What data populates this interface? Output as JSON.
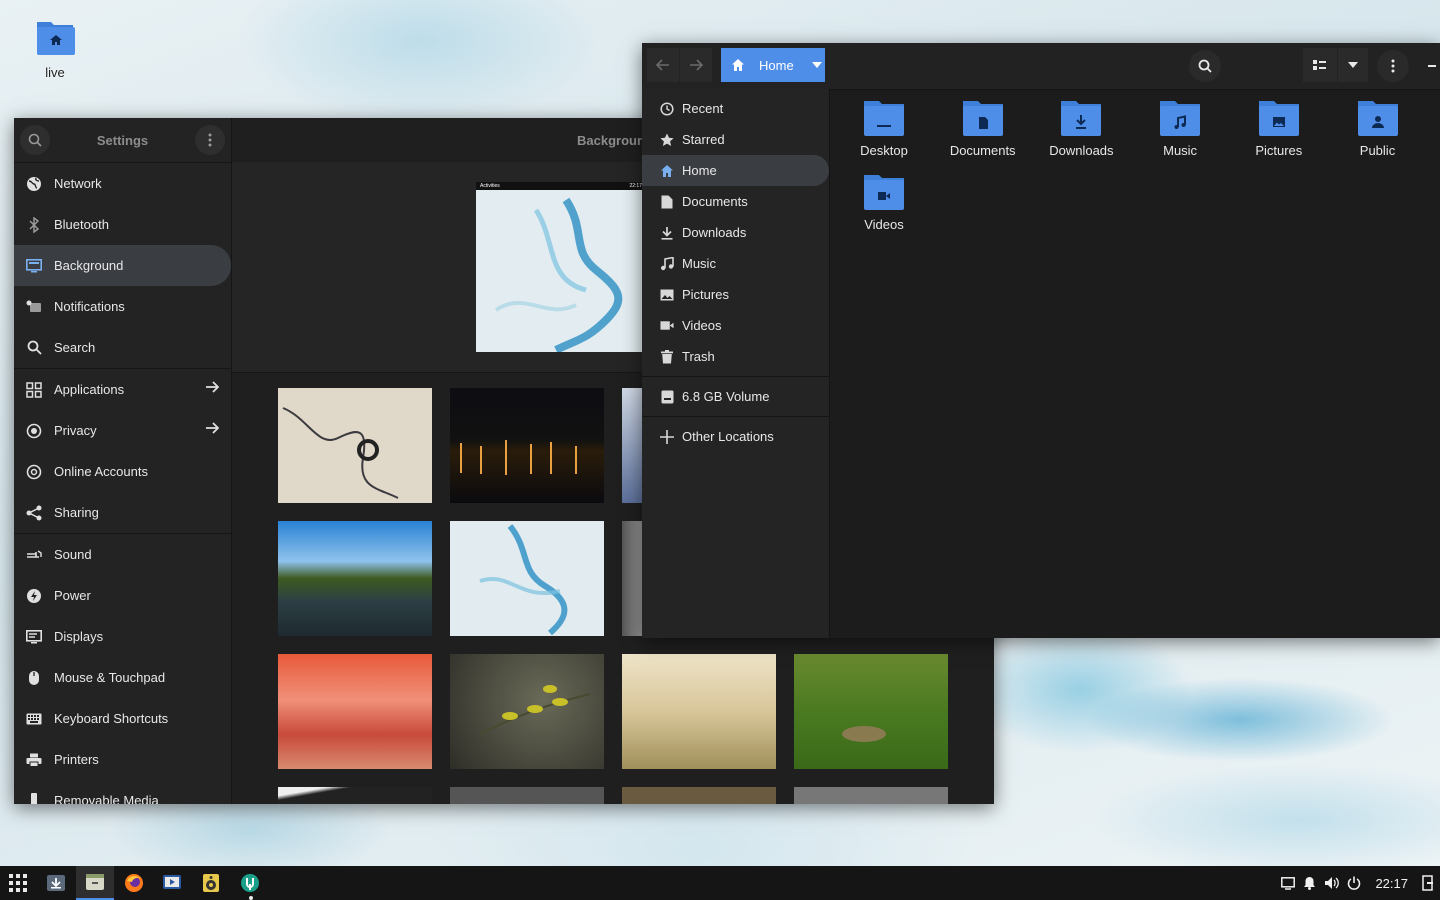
{
  "desktop": {
    "home_label": "live"
  },
  "settings": {
    "title": "Settings",
    "page_title": "Background",
    "preview": {
      "activities": "Activities",
      "time": "22:17"
    },
    "items": [
      {
        "label": "Network",
        "icon": "globe-icon"
      },
      {
        "label": "Bluetooth",
        "icon": "bluetooth-icon"
      },
      {
        "label": "Background",
        "icon": "monitor-icon"
      },
      {
        "label": "Notifications",
        "icon": "bell-icon"
      },
      {
        "label": "Search",
        "icon": "search-icon"
      },
      {
        "label": "Applications",
        "icon": "grid-icon"
      },
      {
        "label": "Privacy",
        "icon": "privacy-icon"
      },
      {
        "label": "Online Accounts",
        "icon": "at-icon"
      },
      {
        "label": "Sharing",
        "icon": "share-icon"
      },
      {
        "label": "Sound",
        "icon": "speaker-icon"
      },
      {
        "label": "Power",
        "icon": "power-icon"
      },
      {
        "label": "Displays",
        "icon": "display-icon"
      },
      {
        "label": "Mouse & Touchpad",
        "icon": "mouse-icon"
      },
      {
        "label": "Keyboard Shortcuts",
        "icon": "keyboard-icon"
      },
      {
        "label": "Printers",
        "icon": "printer-icon"
      },
      {
        "label": "Removable Media",
        "icon": "usb-icon"
      }
    ],
    "selected": "Background"
  },
  "files": {
    "path": "Home",
    "sidebar": [
      {
        "label": "Recent",
        "icon": "clock-icon"
      },
      {
        "label": "Starred",
        "icon": "star-icon"
      },
      {
        "label": "Home",
        "icon": "home-icon"
      },
      {
        "label": "Documents",
        "icon": "document-icon"
      },
      {
        "label": "Downloads",
        "icon": "download-icon"
      },
      {
        "label": "Music",
        "icon": "music-icon"
      },
      {
        "label": "Pictures",
        "icon": "picture-icon"
      },
      {
        "label": "Videos",
        "icon": "video-icon"
      },
      {
        "label": "Trash",
        "icon": "trash-icon"
      }
    ],
    "volume": "6.8 GB Volume",
    "other_locations": "Other Locations",
    "folders": [
      "Desktop",
      "Documents",
      "Downloads",
      "Music",
      "Pictures",
      "Public",
      "Videos"
    ]
  },
  "taskbar": {
    "clock": "22:17",
    "apps": [
      "apps-grid-icon",
      "installer-icon",
      "files-icon",
      "firefox-icon",
      "screen-recorder-icon",
      "speaker-app-icon",
      "settings-app-icon"
    ]
  },
  "colors": {
    "accent": "#4f8ee8",
    "folder": "#4f8ee8",
    "window_bg": "#1f1f1f"
  }
}
